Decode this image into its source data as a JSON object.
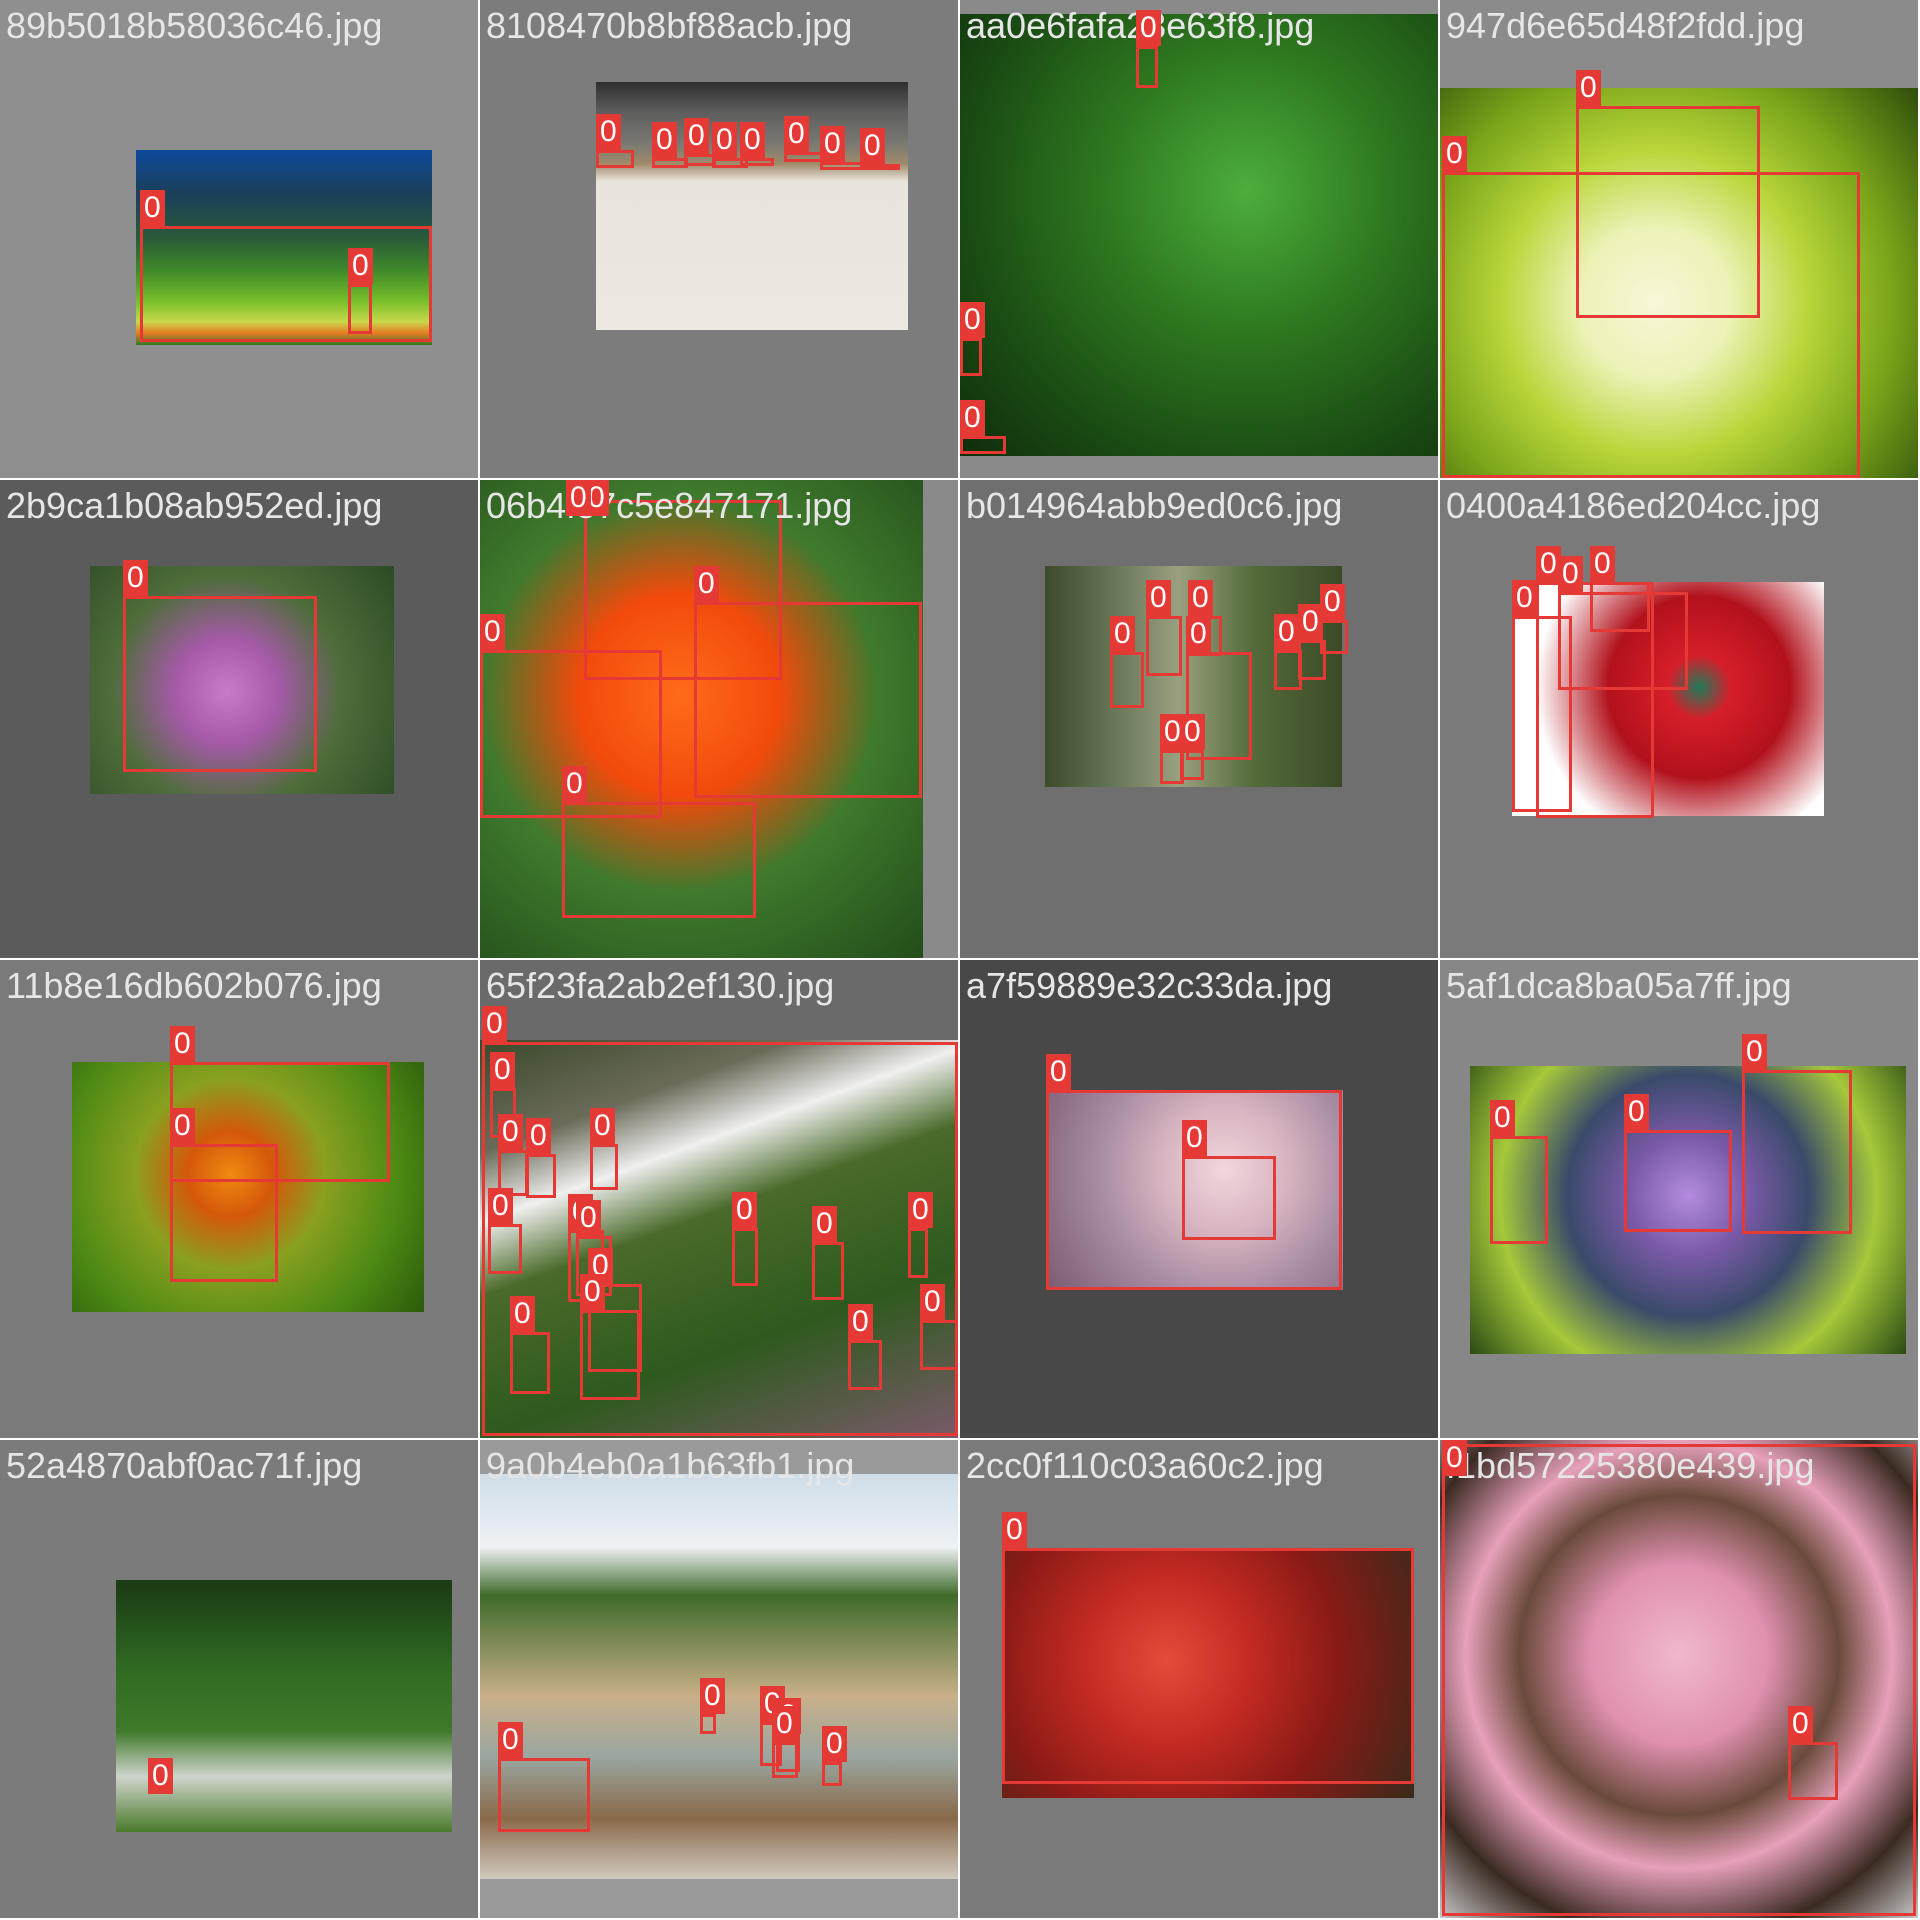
{
  "colors": {
    "box": "#e53935",
    "label_text": "#ffffff",
    "filename_text": "#e6e6e6"
  },
  "tiles": [
    {
      "filename": "89b5018b58036c46.jpg",
      "background": "#8f8f8f",
      "scene": "hillside-meadow",
      "detections": [
        {
          "label": "0"
        },
        {
          "label": "0"
        }
      ]
    },
    {
      "filename": "8108470b8bf88acb.jpg",
      "background": "#7c7c7c",
      "scene": "street-walker",
      "detections": [
        {
          "label": "0"
        },
        {
          "label": "0"
        },
        {
          "label": "0"
        },
        {
          "label": "0"
        },
        {
          "label": "0"
        },
        {
          "label": "0"
        },
        {
          "label": "0"
        },
        {
          "label": "0"
        }
      ]
    },
    {
      "filename": "aa0e6fafa23e63f8.jpg",
      "background": "#8a8a8a",
      "scene": "green-leaves",
      "detections": [
        {
          "label": "0"
        },
        {
          "label": "0"
        },
        {
          "label": "0"
        }
      ]
    },
    {
      "filename": "947d6e65d48f2fdd.jpg",
      "background": "#8b8b8b",
      "scene": "white-bougainvillea",
      "detections": [
        {
          "label": "0"
        },
        {
          "label": "0"
        }
      ]
    },
    {
      "filename": "2b9ca1b08ab952ed.jpg",
      "background": "#5b5b5b",
      "scene": "purple-orchids",
      "detections": [
        {
          "label": "0"
        }
      ]
    },
    {
      "filename": "06b4f57c5e847171.jpg",
      "background": "#8a8a8a",
      "scene": "orange-orchids",
      "detections": [
        {
          "label": "0"
        },
        {
          "label": "0"
        },
        {
          "label": "0"
        },
        {
          "label": "0"
        },
        {
          "label": "0"
        }
      ]
    },
    {
      "filename": "b014964abb9ed0c6.jpg",
      "background": "#6f6f6f",
      "scene": "rotated-garden",
      "detections": [
        {
          "label": "0"
        },
        {
          "label": "0"
        },
        {
          "label": "0"
        },
        {
          "label": "0"
        },
        {
          "label": "0"
        },
        {
          "label": "0"
        },
        {
          "label": "0"
        },
        {
          "label": "0"
        },
        {
          "label": "0"
        }
      ]
    },
    {
      "filename": "0400a4186ed204cc.jpg",
      "background": "#7a7a7a",
      "scene": "red-gerbera",
      "detections": [
        {
          "label": "0"
        },
        {
          "label": "0"
        },
        {
          "label": "0"
        },
        {
          "label": "0"
        }
      ]
    },
    {
      "filename": "11b8e16db602b076.jpg",
      "background": "#7a7a7a",
      "scene": "orange-tulips",
      "detections": [
        {
          "label": "0"
        },
        {
          "label": "0"
        }
      ]
    },
    {
      "filename": "65f23fa2ab2ef130.jpg",
      "background": "#6a6a6a",
      "scene": "tree-white-flowers",
      "detections": [
        {
          "label": "0"
        },
        {
          "label": "0"
        },
        {
          "label": "0"
        },
        {
          "label": "0"
        },
        {
          "label": "0"
        },
        {
          "label": "0"
        },
        {
          "label": "0"
        },
        {
          "label": "0"
        },
        {
          "label": "0"
        },
        {
          "label": "0"
        },
        {
          "label": "0"
        },
        {
          "label": "0"
        },
        {
          "label": "0"
        },
        {
          "label": "0"
        },
        {
          "label": "0"
        },
        {
          "label": "0"
        }
      ]
    },
    {
      "filename": "a7f59889e32c33da.jpg",
      "background": "#484848",
      "scene": "cherry-blossom-blur",
      "detections": [
        {
          "label": "0"
        },
        {
          "label": "0"
        }
      ]
    },
    {
      "filename": "5af1dca8ba05a7ff.jpg",
      "background": "#878787",
      "scene": "purple-anemones",
      "detections": [
        {
          "label": "0"
        },
        {
          "label": "0"
        },
        {
          "label": "0"
        }
      ]
    },
    {
      "filename": "52a4870abf0ac71f.jpg",
      "background": "#7b7b7b",
      "scene": "park-trees",
      "detections": [
        {
          "label": "0"
        }
      ]
    },
    {
      "filename": "9a0b4eb0a1b63fb1.jpg",
      "background": "#9a9a9a",
      "scene": "courtyard-pots",
      "detections": [
        {
          "label": "0"
        },
        {
          "label": "0"
        },
        {
          "label": "0"
        },
        {
          "label": "0"
        },
        {
          "label": "0"
        },
        {
          "label": "0"
        }
      ]
    },
    {
      "filename": "2cc0f110c03a60c2.jpg",
      "background": "#7a7a7a",
      "scene": "red-amaryllis",
      "detections": [
        {
          "label": "0"
        }
      ]
    },
    {
      "filename": "f1bd57225380e439.jpg",
      "background": "#9a9a9a",
      "scene": "pink-blossom-branches",
      "detections": [
        {
          "label": "0"
        },
        {
          "label": "0"
        }
      ]
    }
  ]
}
